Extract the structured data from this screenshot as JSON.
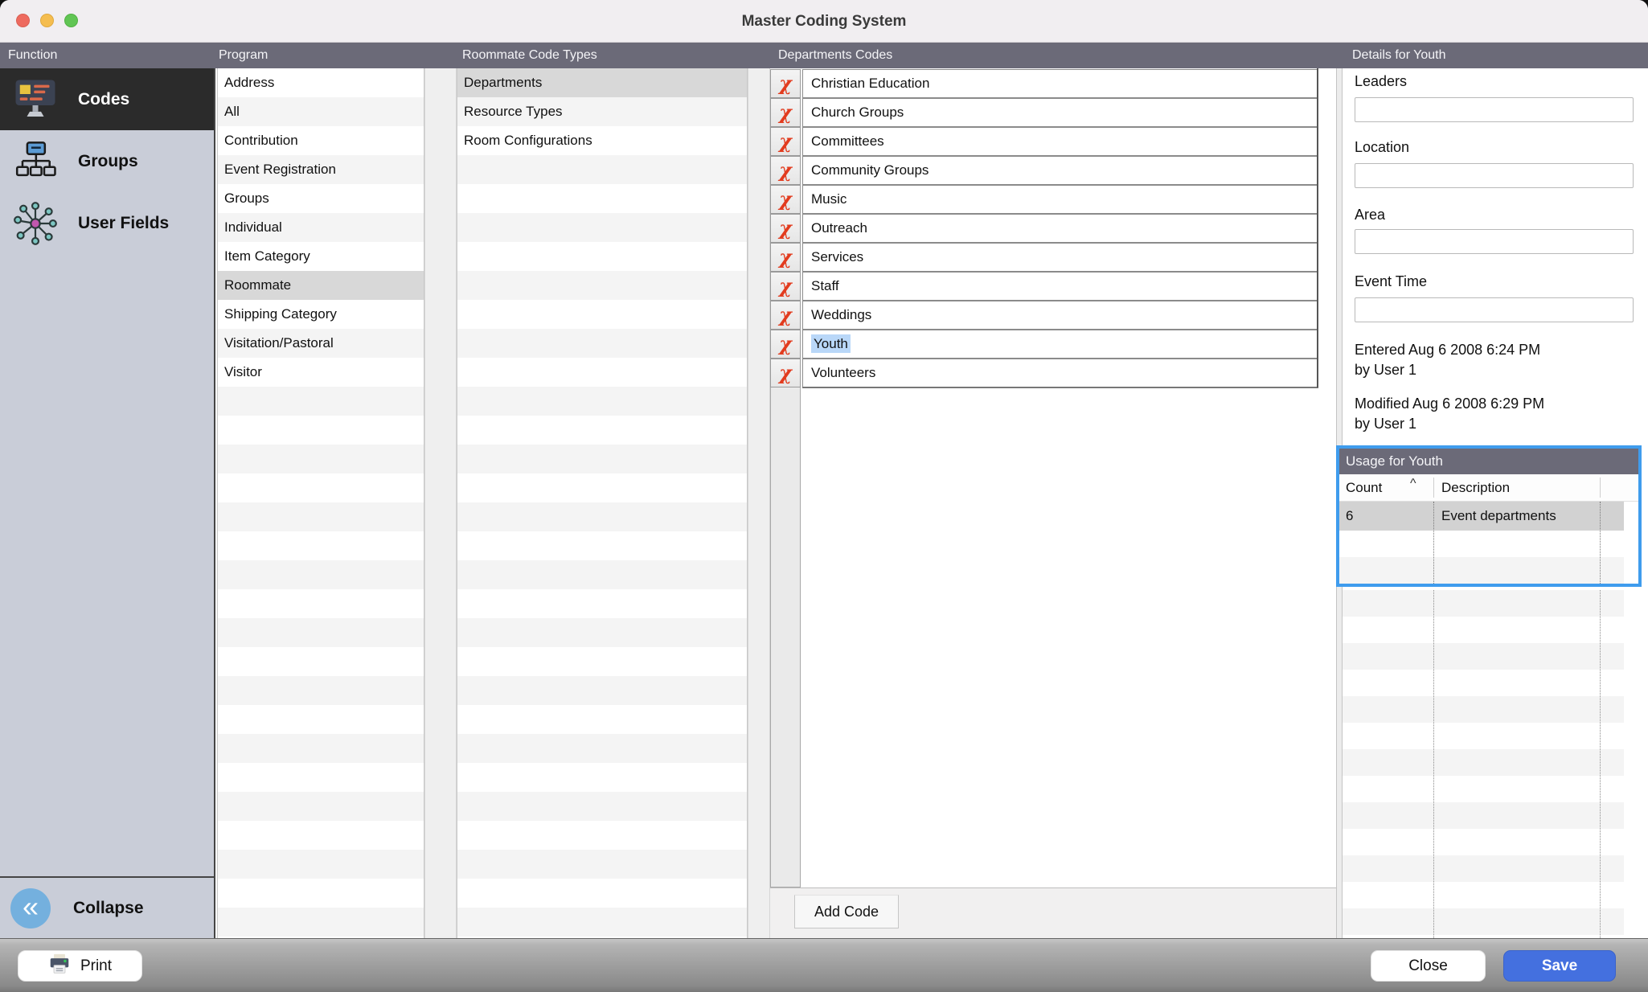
{
  "window": {
    "title": "Master Coding System"
  },
  "column_headers": {
    "function": "Function",
    "program": "Program",
    "code_types": "Roommate Code Types",
    "codes": "Departments Codes",
    "details": "Details for Youth"
  },
  "sidebar": {
    "codes_label": "Codes",
    "groups_label": "Groups",
    "user_fields_label": "User Fields",
    "collapse_label": "Collapse"
  },
  "program_list": {
    "items": [
      "Address",
      "All",
      "Contribution",
      "Event Registration",
      "Groups",
      "Individual",
      "Item Category",
      "Roommate",
      "Shipping Category",
      "Visitation/Pastoral",
      "Visitor"
    ],
    "selected": "Roommate"
  },
  "code_types_list": {
    "items": [
      "Departments",
      "Resource Types",
      "Room Configurations"
    ],
    "selected": "Departments"
  },
  "department_codes": {
    "items": [
      "Christian Education",
      "Church Groups",
      "Committees",
      "Community Groups",
      "Music",
      "Outreach",
      "Services",
      "Staff",
      "Weddings",
      "Youth",
      "Volunteers"
    ],
    "selected": "Youth",
    "add_button_label": "Add Code"
  },
  "details": {
    "leaders_label": "Leaders",
    "leaders_value": "",
    "location_label": "Location",
    "location_value": "",
    "area_label": "Area",
    "area_value": "",
    "event_time_label": "Event Time",
    "event_time_value": "",
    "entered_line1": "Entered Aug 6 2008 6:24 PM",
    "entered_line2": "by User 1",
    "modified_line1": "Modified Aug 6 2008 6:29 PM",
    "modified_line2": "by User 1",
    "usage": {
      "title": "Usage for Youth",
      "count_header": "Count",
      "description_header": "Description",
      "rows": [
        {
          "count": "6",
          "description": "Event departments"
        }
      ]
    }
  },
  "footer": {
    "print_label": "Print",
    "close_label": "Close",
    "save_label": "Save"
  },
  "icons": {
    "delete_code_glyph": "χ",
    "sort_asc_glyph": "^",
    "collapse_glyph": "«"
  },
  "colors": {
    "header_bar": "#6B6A78",
    "focus_blue": "#3F9CED",
    "save_blue": "#4470DF",
    "selection_highlight": "#B9D7F8",
    "delete_red": "#E23B1E",
    "sidebar_bg": "#C9CDD8",
    "selected_row": "#D8D8D8"
  }
}
